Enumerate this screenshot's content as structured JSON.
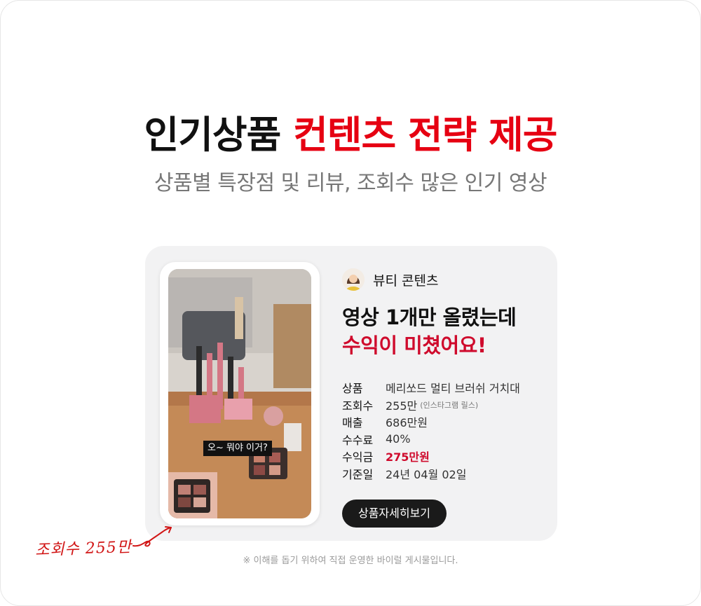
{
  "headline": {
    "black": "인기상품",
    "red": "컨텐츠 전략 제공"
  },
  "subheadline": "상품별 특장점 및 리뷰, 조회수 많은 인기 영상",
  "card": {
    "video_caption": "오~ 뭐야 이거?",
    "creator_name": "뷰티 콘텐츠",
    "title_line1": "영상 1개만 올렸는데",
    "title_line2": "수익이 미쳤어요!",
    "specs": [
      {
        "label": "상품",
        "value": "메리쏘드 멀티 브러쉬 거치대",
        "note": ""
      },
      {
        "label": "조회수",
        "value": "255만",
        "note": "(인스타그램 릴스)"
      },
      {
        "label": "매출",
        "value": "686만원",
        "note": ""
      },
      {
        "label": "수수료",
        "value": "40%",
        "note": ""
      },
      {
        "label": "수익금",
        "value": "275만원",
        "note": ""
      },
      {
        "label": "기준일",
        "value": "24년 04월 02일",
        "note": ""
      }
    ],
    "detail_button": "상품자세히보기"
  },
  "annotation": "조회수 255만",
  "footnote": "※ 이해를 돕기 위하여 직접 운영한 바이럴 게시물입니다.",
  "colors": {
    "accent_red": "#e60012",
    "title_red": "#cf0a2c",
    "card_bg": "#f2f2f3",
    "button_bg": "#1a1a1a"
  },
  "icons": [
    "avatar-illustration",
    "hand-drawn-arrow-icon"
  ]
}
